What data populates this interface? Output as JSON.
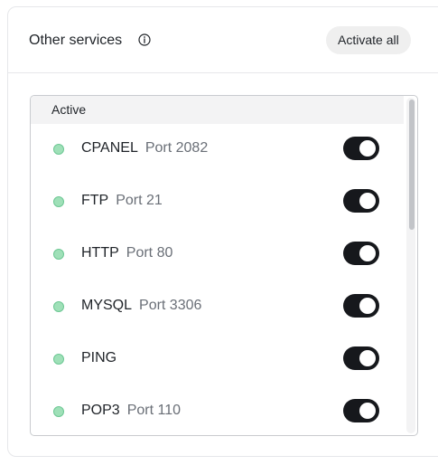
{
  "header": {
    "title": "Other services",
    "info_icon": "info-circle-icon",
    "activate_all_label": "Activate all"
  },
  "list": {
    "group_label": "Active",
    "items": [
      {
        "name": "CPANEL",
        "port": "Port 2082",
        "status": "active",
        "enabled": true
      },
      {
        "name": "FTP",
        "port": "Port 21",
        "status": "active",
        "enabled": true
      },
      {
        "name": "HTTP",
        "port": "Port 80",
        "status": "active",
        "enabled": true
      },
      {
        "name": "MYSQL",
        "port": "Port 3306",
        "status": "active",
        "enabled": true
      },
      {
        "name": "PING",
        "port": "",
        "status": "active",
        "enabled": true
      },
      {
        "name": "POP3",
        "port": "Port 110",
        "status": "active",
        "enabled": true
      }
    ]
  },
  "colors": {
    "status_active": "#9fe0b8",
    "toggle_on": "#16181c",
    "button_bg": "#efefef"
  }
}
